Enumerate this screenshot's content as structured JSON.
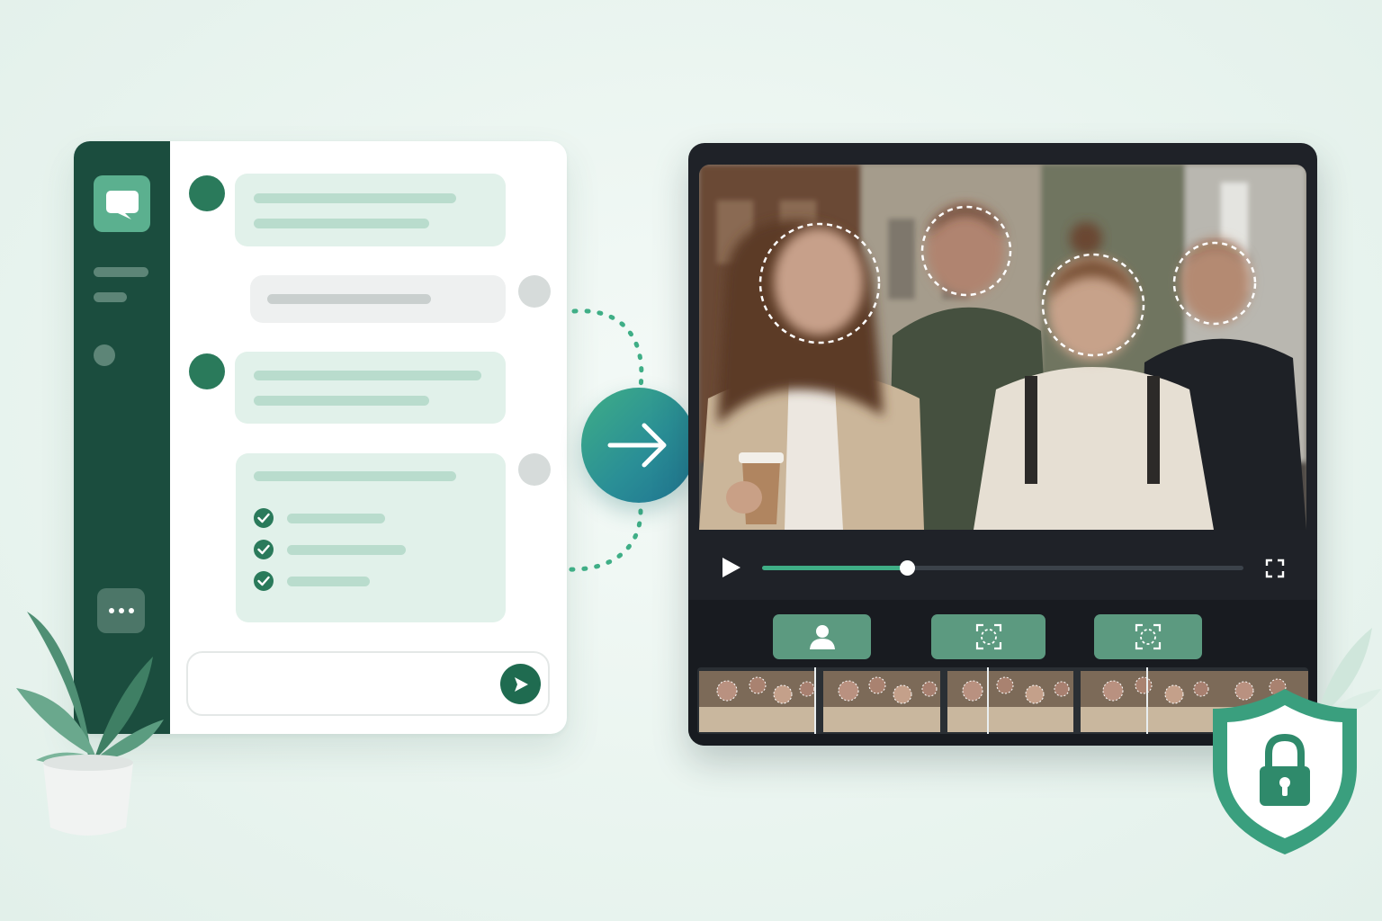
{
  "chat_app": {
    "sidebar": {
      "logo_icon": "chat-bubble-icon",
      "more_icon": "ellipsis-icon"
    },
    "messages": [
      {
        "sender": "contact",
        "type": "placeholder"
      },
      {
        "sender": "user",
        "type": "placeholder"
      },
      {
        "sender": "contact",
        "type": "placeholder"
      },
      {
        "sender": "user",
        "type": "checklist",
        "checked_items": 3
      }
    ],
    "composer": {
      "value": "",
      "send_icon": "send-icon"
    }
  },
  "connector": {
    "icon": "arrow-right-icon"
  },
  "video_editor": {
    "detected_faces": 4,
    "playback": {
      "progress": 0.3,
      "play_icon": "play-icon",
      "fullscreen_icon": "fullscreen-icon"
    },
    "tools": [
      {
        "icon": "person-icon"
      },
      {
        "icon": "face-scan-icon"
      },
      {
        "icon": "face-scan-icon"
      }
    ],
    "filmstrip_frames": 4
  },
  "badges": {
    "security_icon": "shield-lock-icon"
  },
  "colors": {
    "brand_dark": "#1b4d3e",
    "brand_accent": "#2a7a5b",
    "brand_light": "#e1f1ea",
    "editor_bg": "#1f2228",
    "progress": "#3fae86"
  }
}
